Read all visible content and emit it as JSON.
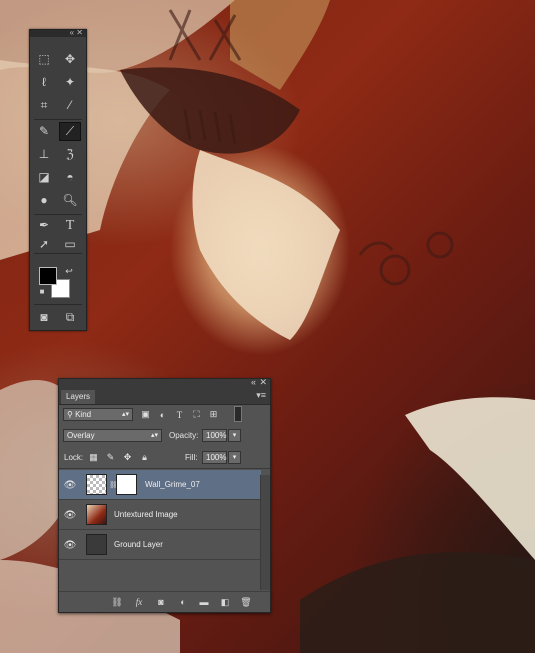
{
  "toolbox": {
    "icons": [
      "marquee-icon",
      "move-icon",
      "lasso-icon",
      "magic-wand-icon",
      "crop-icon",
      "eyedropper-icon",
      "healing-brush-icon",
      "brush-icon",
      "clone-stamp-icon",
      "history-brush-icon",
      "eraser-icon",
      "paint-bucket-icon",
      "blur-icon",
      "dodge-icon",
      "pen-icon",
      "type-icon",
      "path-selection-icon",
      "rectangle-icon",
      "hand-icon",
      "zoom-icon"
    ],
    "active_tool": "brush-icon",
    "foreground_color": "#000000",
    "background_color": "#ffffff"
  },
  "layers_panel": {
    "tab_label": "Layers",
    "filter": {
      "selected": "Kind"
    },
    "blend_mode": {
      "selected": "Overlay"
    },
    "opacity": {
      "label": "Opacity:",
      "value": "100%"
    },
    "lock": {
      "label": "Lock:"
    },
    "fill": {
      "label": "Fill:",
      "value": "100%"
    },
    "layers": [
      {
        "name": "Wall_Grime_07",
        "selected": true,
        "visible": true
      },
      {
        "name": "Untextured Image",
        "selected": false,
        "visible": true
      },
      {
        "name": "Ground Layer",
        "selected": false,
        "visible": true
      }
    ],
    "bottom_icons": [
      "link-layers-icon",
      "fx-icon",
      "add-mask-icon",
      "adjustment-layer-icon",
      "new-group-icon",
      "new-layer-icon",
      "delete-layer-icon"
    ]
  }
}
